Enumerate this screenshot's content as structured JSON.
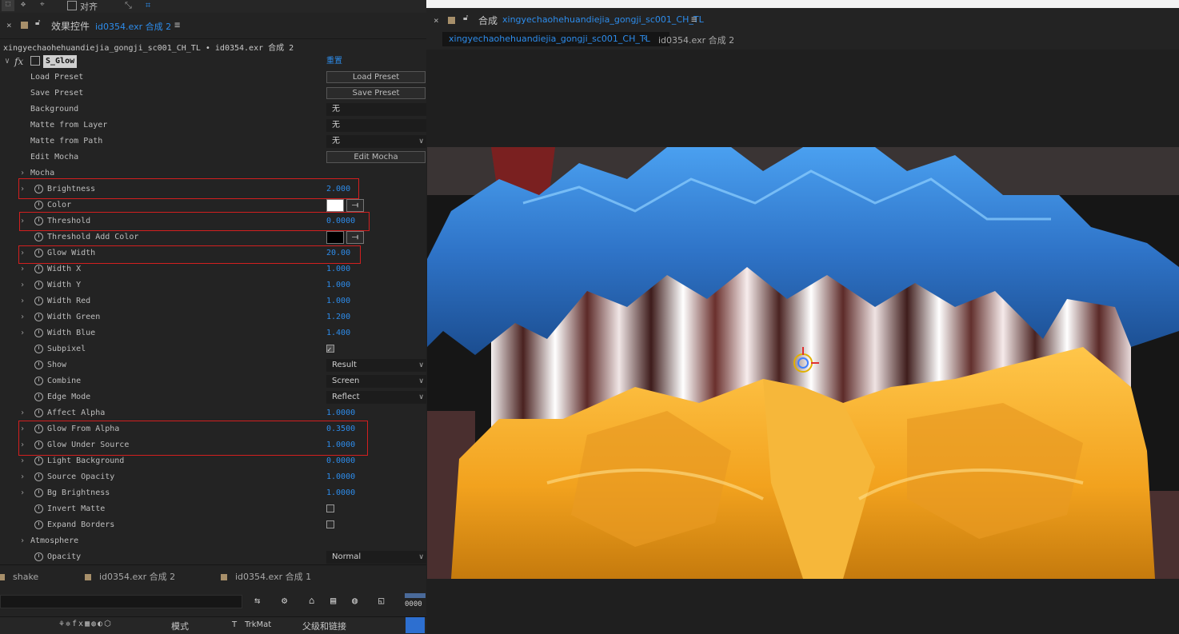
{
  "toolbar": {
    "align_label": "对齐"
  },
  "effect_controls": {
    "tab_label": "效果控件",
    "tab_target": "id0354.exr 合成 2",
    "path": "xingyechaohehuandiejia_gongji_sc001_CH_TL • id0354.exr 合成 2",
    "effect_name": "S_Glow",
    "reset_label": "重置",
    "properties": [
      {
        "label": "Load Preset",
        "kind": "button",
        "value": "Load Preset"
      },
      {
        "label": "Save Preset",
        "kind": "button",
        "value": "Save Preset"
      },
      {
        "label": "Background",
        "kind": "dropdown",
        "value": "无"
      },
      {
        "label": "Matte from Layer",
        "kind": "dropdown",
        "value": "无"
      },
      {
        "label": "Matte from Path",
        "kind": "dropdown",
        "value": "无"
      },
      {
        "label": "Edit Mocha",
        "kind": "button",
        "value": "Edit Mocha"
      },
      {
        "label": "Mocha",
        "kind": "group"
      },
      {
        "label": "Brightness",
        "kind": "number",
        "value": "2.000"
      },
      {
        "label": "Color",
        "kind": "color",
        "color": "#ffffff"
      },
      {
        "label": "Threshold",
        "kind": "number",
        "value": "0.0000"
      },
      {
        "label": "Threshold Add Color",
        "kind": "color",
        "color": "#000000"
      },
      {
        "label": "Glow Width",
        "kind": "number",
        "value": "20.00"
      },
      {
        "label": "Width X",
        "kind": "number",
        "value": "1.000"
      },
      {
        "label": "Width Y",
        "kind": "number",
        "value": "1.000"
      },
      {
        "label": "Width Red",
        "kind": "number",
        "value": "1.000"
      },
      {
        "label": "Width Green",
        "kind": "number",
        "value": "1.200"
      },
      {
        "label": "Width Blue",
        "kind": "number",
        "value": "1.400"
      },
      {
        "label": "Subpixel",
        "kind": "checkbox",
        "checked": true
      },
      {
        "label": "Show",
        "kind": "dropdown",
        "value": "Result"
      },
      {
        "label": "Combine",
        "kind": "dropdown",
        "value": "Screen"
      },
      {
        "label": "Edge Mode",
        "kind": "dropdown",
        "value": "Reflect"
      },
      {
        "label": "Affect Alpha",
        "kind": "number",
        "value": "1.0000"
      },
      {
        "label": "Glow From Alpha",
        "kind": "number",
        "value": "0.3500"
      },
      {
        "label": "Glow Under Source",
        "kind": "number",
        "value": "1.0000"
      },
      {
        "label": "Light Background",
        "kind": "number",
        "value": "0.0000"
      },
      {
        "label": "Source Opacity",
        "kind": "number",
        "value": "1.0000"
      },
      {
        "label": "Bg Brightness",
        "kind": "number",
        "value": "1.0000"
      },
      {
        "label": "Invert Matte",
        "kind": "checkbox",
        "checked": false
      },
      {
        "label": "Expand Borders",
        "kind": "checkbox",
        "checked": false
      },
      {
        "label": "Atmosphere",
        "kind": "group"
      },
      {
        "label": "Opacity",
        "kind": "dropdown",
        "value": "Normal"
      }
    ]
  },
  "timeline": {
    "tabs": [
      "shake",
      "id0354.exr 合成 2",
      "id0354.exr 合成 1"
    ],
    "timecode": "0000",
    "columns": {
      "mode": "模式",
      "t": "T",
      "trkmat": "TrkMat",
      "parent": "父级和链接"
    }
  },
  "composition": {
    "tab_prefix": "合成",
    "tab_name": "xingyechaohehuandiejia_gongji_sc001_CH_TL",
    "breadcrumb_active": "xingyechaohehuandiejia_gongji_sc001_CH_TL",
    "breadcrumb_next": "id0354.exr 合成 2"
  },
  "colors": {
    "accent_blue": "#2d8ceb",
    "highlight_red": "#d21f1f",
    "label_square": "#a78f6a"
  }
}
